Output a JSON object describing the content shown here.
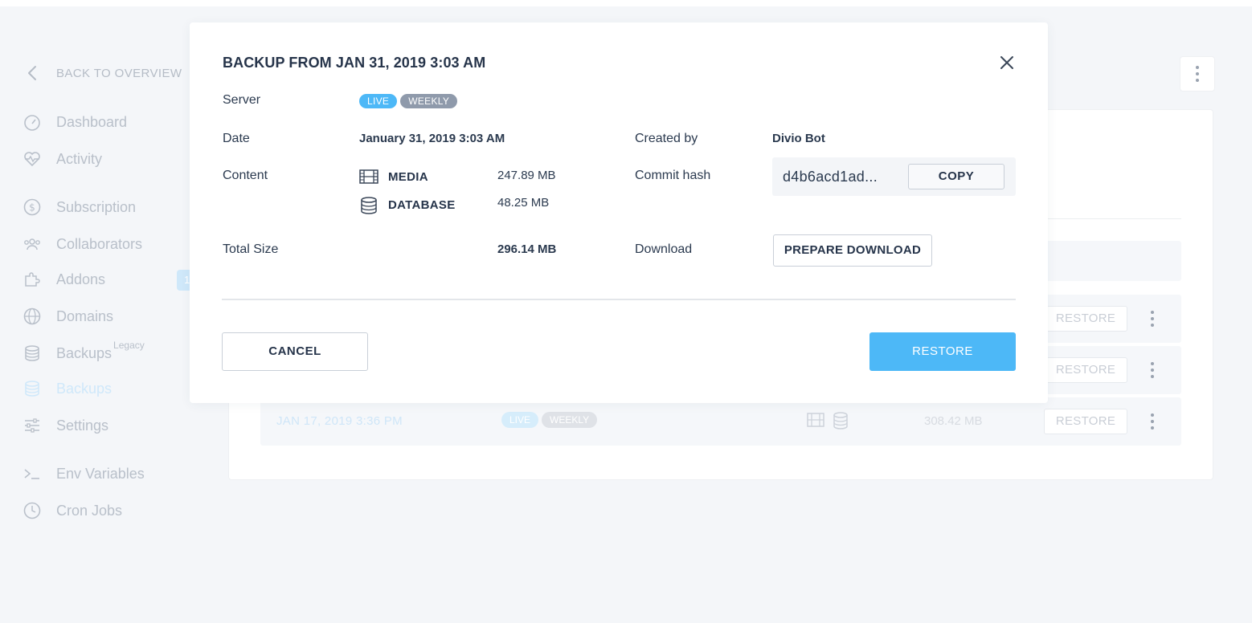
{
  "sidebar": {
    "back_label": "BACK TO OVERVIEW",
    "items": [
      {
        "label": "Dashboard",
        "icon": "speedometer-icon"
      },
      {
        "label": "Activity",
        "icon": "heartbeat-icon"
      },
      {
        "label": "Subscription",
        "icon": "dollar-icon"
      },
      {
        "label": "Collaborators",
        "icon": "people-icon"
      },
      {
        "label": "Addons",
        "icon": "puzzle-icon"
      },
      {
        "label": "Domains",
        "icon": "globe-icon"
      },
      {
        "label": "Backups",
        "icon": "database-icon",
        "sup": "Legacy"
      },
      {
        "label": "Backups",
        "icon": "database-icon",
        "active": true
      },
      {
        "label": "Settings",
        "icon": "sliders-icon"
      },
      {
        "label": "Env Variables",
        "icon": "terminal-icon"
      },
      {
        "label": "Cron Jobs",
        "icon": "clock-icon"
      }
    ],
    "addons_count": "1"
  },
  "background": {
    "rows": [
      {
        "restore": "RESTORE"
      },
      {
        "restore": "RESTORE"
      },
      {
        "date": "JAN 17, 2019 3:36 PM",
        "server": "LIVE",
        "schedule": "WEEKLY",
        "size": "308.42 MB",
        "restore": "RESTORE"
      }
    ]
  },
  "modal": {
    "title": "BACKUP FROM JAN 31, 2019 3:03 AM",
    "server_label": "Server",
    "server_tags": {
      "env": "LIVE",
      "schedule": "WEEKLY"
    },
    "date_label": "Date",
    "date_value": "January 31, 2019 3:03 AM",
    "created_by_label": "Created by",
    "created_by_value": "Divio Bot",
    "content_label": "Content",
    "media_label": "MEDIA",
    "media_size": "247.89 MB",
    "database_label": "DATABASE",
    "database_size": "48.25 MB",
    "commit_hash_label": "Commit hash",
    "commit_hash_value": "d4b6acd1ad...",
    "copy_label": "COPY",
    "total_size_label": "Total Size",
    "total_size_value": "296.14 MB",
    "download_label": "Download",
    "prepare_download_label": "PREPARE DOWNLOAD",
    "cancel_label": "CANCEL",
    "restore_label": "RESTORE"
  },
  "colors": {
    "accent": "#4db8f7",
    "tag_weekly": "#8f9aab",
    "text_primary": "#26344a"
  }
}
